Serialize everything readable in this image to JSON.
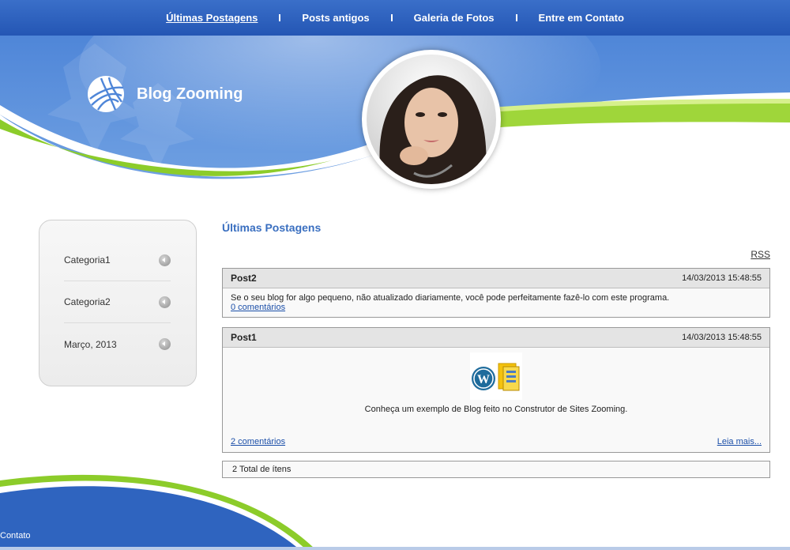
{
  "nav": {
    "items": [
      {
        "label": "Últimas Postagens"
      },
      {
        "label": "Posts antigos"
      },
      {
        "label": "Galeria de Fotos"
      },
      {
        "label": "Entre em Contato"
      }
    ]
  },
  "header": {
    "site_title": "Blog Zooming"
  },
  "sidebar": {
    "items": [
      {
        "label": "Categoria1"
      },
      {
        "label": "Categoria2"
      },
      {
        "label": "Março, 2013"
      }
    ]
  },
  "main": {
    "title": "Últimas Postagens",
    "rss_label": "RSS",
    "posts": [
      {
        "title": "Post2",
        "date": "14/03/2013 15:48:55",
        "text": "Se o seu blog for algo pequeno, não atualizado diariamente, você pode perfeitamente fazê-lo com este programa.",
        "comments": "0 comentários"
      },
      {
        "title": "Post1",
        "date": "14/03/2013 15:48:55",
        "text": "Conheça um exemplo de Blog feito no Construtor de Sites Zooming.",
        "comments": "2 comentários",
        "more": "Leia mais..."
      }
    ],
    "total": "2 Total de ítens"
  },
  "footer": {
    "text": "Contato"
  },
  "colors": {
    "nav_blue": "#2456b4",
    "banner_blue": "#3a72cc",
    "accent_green": "#8ccc2a",
    "title_blue": "#3a6fc0",
    "link_blue": "#1a4ea8"
  }
}
